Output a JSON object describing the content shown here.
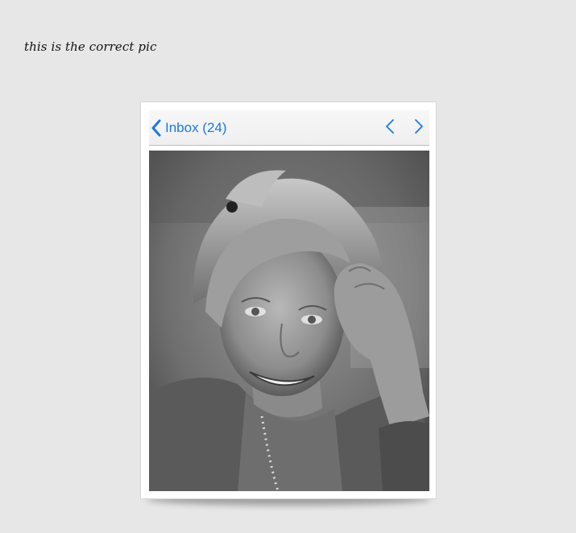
{
  "caption": "this is the correct pic",
  "mail": {
    "back_label": "Inbox (24)",
    "back_icon": "chevron-left-icon",
    "prev_icon": "chevron-left-icon",
    "next_icon": "chevron-right-icon",
    "accent_color": "#1a7ae0"
  },
  "photo": {
    "description_icon": "portrait-photo",
    "style": "black-and-white"
  }
}
